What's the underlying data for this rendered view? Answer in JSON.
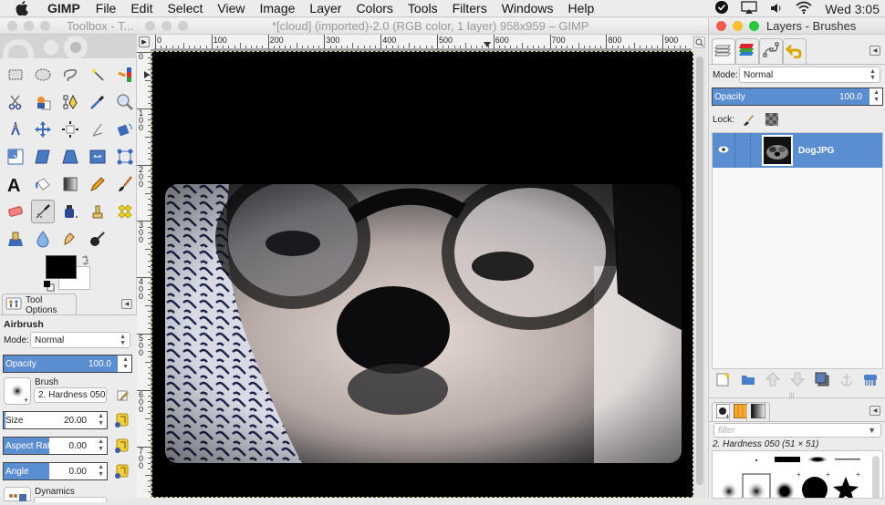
{
  "menubar": {
    "app_name": "GIMP",
    "items": [
      "File",
      "Edit",
      "Select",
      "View",
      "Image",
      "Layer",
      "Colors",
      "Tools",
      "Filters",
      "Windows",
      "Help"
    ],
    "clock": "Wed 3:05",
    "status_icons": [
      "checkmark-circle-icon",
      "airplay-icon",
      "volume-icon",
      "wifi-icon"
    ]
  },
  "toolbox_window": {
    "title": "Toolbox - T...",
    "tools": [
      "rect-select",
      "ellipse-select",
      "free-select",
      "fuzzy-select",
      "select-by-color",
      "scissors-select",
      "foreground-select",
      "paths",
      "color-picker",
      "zoom",
      "measure",
      "move",
      "align",
      "crop",
      "rotate",
      "scale",
      "shear",
      "perspective",
      "flip",
      "cage-transform",
      "text",
      "bucket-fill",
      "blend",
      "pencil",
      "paintbrush",
      "eraser",
      "airbrush",
      "ink",
      "clone",
      "heal",
      "perspective-clone",
      "blur-sharpen",
      "smudge",
      "dodge-burn"
    ],
    "active_tool": "airbrush",
    "fg_color": "#000000",
    "bg_color": "#ffffff"
  },
  "tool_options": {
    "tab_label": "Tool Options",
    "tool_name": "Airbrush",
    "mode_label": "Mode:",
    "mode_value": "Normal",
    "opacity_label": "Opacity",
    "opacity_value": "100.0",
    "brush_label": "Brush",
    "brush_value": "2. Hardness 050",
    "size_label": "Size",
    "size_value": "20.00",
    "size_fraction": 0.02,
    "aspect_label": "Aspect Ratio",
    "aspect_value": "0.00",
    "aspect_fraction": 0.5,
    "angle_label": "Angle",
    "angle_value": "0.00",
    "angle_fraction": 0.5,
    "dynamics_label": "Dynamics"
  },
  "image_window": {
    "title": "*[cloud] (imported)-2.0 (RGB color, 1 layer) 958x959 – GIMP",
    "hruler_labels": [
      "0",
      "100",
      "200",
      "300",
      "400",
      "500",
      "600",
      "700",
      "800",
      "900"
    ],
    "vruler_labels": [
      "0",
      "100",
      "200",
      "300",
      "400",
      "500",
      "600",
      "700"
    ]
  },
  "layers_window": {
    "title": "Layers - Brushes",
    "mode_label": "Mode:",
    "mode_value": "Normal",
    "opacity_label": "Opacity",
    "opacity_value": "100.0",
    "lock_label": "Lock:",
    "layers": [
      {
        "name": "DogJPG",
        "visible": true
      }
    ],
    "accent": "#5b8dd1"
  },
  "brushes": {
    "filter_placeholder": "filter",
    "selected_brush": "2. Hardness 050 (51 × 51)"
  }
}
